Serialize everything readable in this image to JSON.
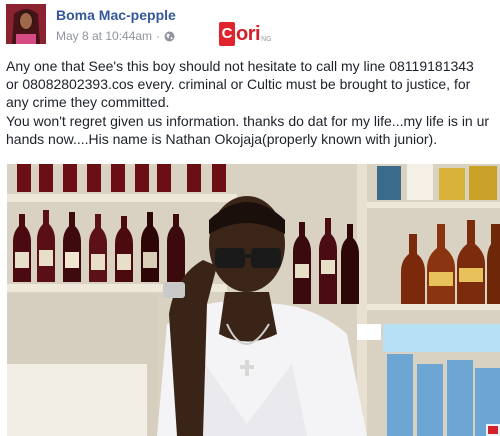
{
  "post": {
    "author": "Boma Mac-pepple",
    "date": "May 8 at 10:44am",
    "separator": "·",
    "privacy_icon": "globe-icon",
    "watermark": {
      "letter": "C",
      "text": "ori",
      "suffix": "NG"
    },
    "text_lines": [
      "Any one that See's this boy should not hesitate to call my line 08119181343",
      "or 08082802393.cos every. criminal or Cultic must be brought to justice, for",
      "any crime they committed.",
      "You won't regret given us information. thanks do dat for my life...my life is in ur",
      "hands now....His name is Nathan Okojaja(properly known with junior)."
    ]
  },
  "colors": {
    "author_link": "#365899",
    "meta_gray": "#90949c",
    "text": "#1d2129",
    "watermark_red": "#e0242c"
  }
}
